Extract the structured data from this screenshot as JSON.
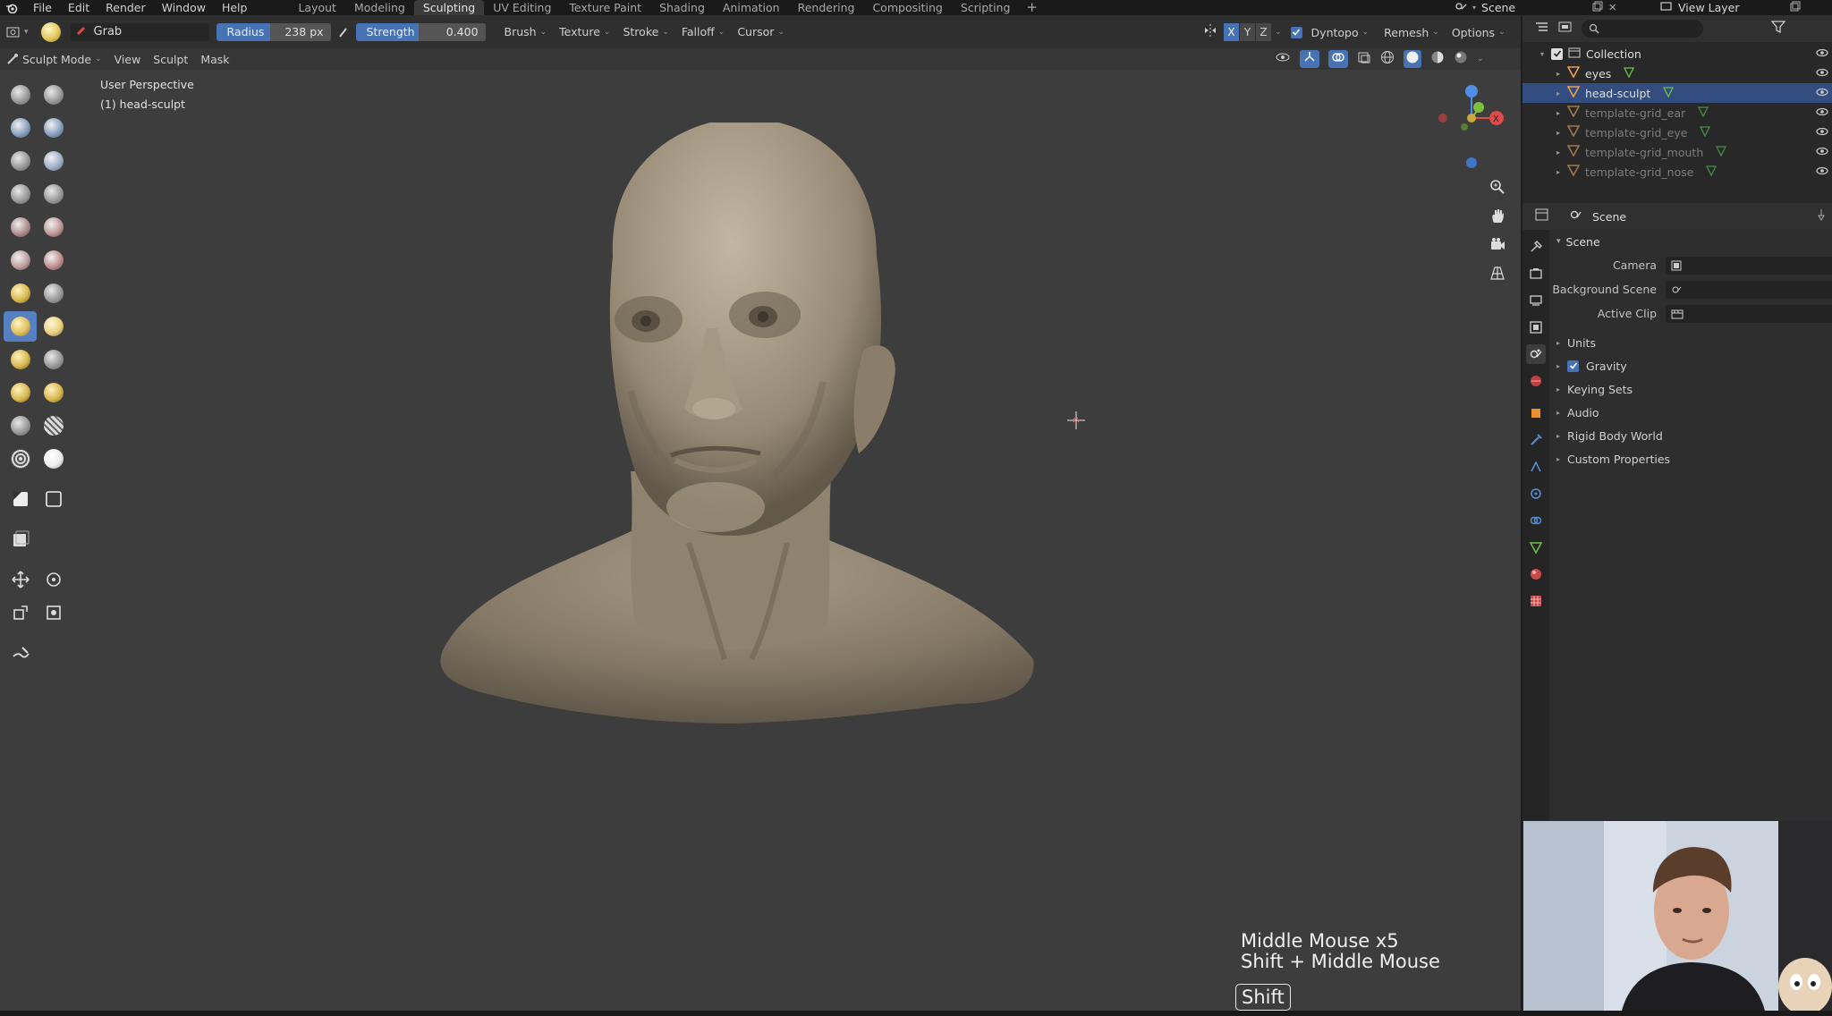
{
  "menubar": {
    "menus": [
      "File",
      "Edit",
      "Render",
      "Window",
      "Help"
    ],
    "workspaces": [
      {
        "label": "Layout",
        "active": false
      },
      {
        "label": "Modeling",
        "active": false
      },
      {
        "label": "Sculpting",
        "active": true
      },
      {
        "label": "UV Editing",
        "active": false
      },
      {
        "label": "Texture Paint",
        "active": false
      },
      {
        "label": "Shading",
        "active": false
      },
      {
        "label": "Animation",
        "active": false
      },
      {
        "label": "Rendering",
        "active": false
      },
      {
        "label": "Compositing",
        "active": false
      },
      {
        "label": "Scripting",
        "active": false
      }
    ],
    "add_workspace": "+",
    "scene": "Scene",
    "view_layer": "View Layer"
  },
  "tool_header": {
    "brush_name": "Grab",
    "radius_label": "Radius",
    "radius_value": "238 px",
    "strength_label": "Strength",
    "strength_value": "0.400",
    "dropdowns": [
      "Brush",
      "Texture",
      "Stroke",
      "Falloff",
      "Cursor"
    ],
    "axes": [
      "X",
      "Y",
      "Z"
    ],
    "dyntopo": "Dyntopo",
    "remesh": "Remesh",
    "options": "Options"
  },
  "mode_header": {
    "mode": "Sculpt Mode",
    "menus": [
      "View",
      "Sculpt",
      "Mask"
    ]
  },
  "viewport": {
    "perspective_label": "User Perspective",
    "object_label": "(1) head-sculpt",
    "screencast_lines": [
      "Middle Mouse x5",
      "Shift + Middle Mouse"
    ],
    "key_pressed": "Shift"
  },
  "outliner": {
    "items": [
      {
        "name": "Collection",
        "indent": 0,
        "selected": false,
        "muted": false
      },
      {
        "name": "eyes",
        "indent": 1,
        "selected": false,
        "muted": false
      },
      {
        "name": "head-sculpt",
        "indent": 1,
        "selected": true,
        "muted": false
      },
      {
        "name": "template-grid_ear",
        "indent": 1,
        "selected": false,
        "muted": true
      },
      {
        "name": "template-grid_eye",
        "indent": 1,
        "selected": false,
        "muted": true
      },
      {
        "name": "template-grid_mouth",
        "indent": 1,
        "selected": false,
        "muted": true
      },
      {
        "name": "template-grid_nose",
        "indent": 1,
        "selected": false,
        "muted": true
      }
    ]
  },
  "properties": {
    "context": "Scene",
    "panel": "Scene",
    "fields": [
      {
        "label": "Camera",
        "value": ""
      },
      {
        "label": "Background Scene",
        "value": ""
      },
      {
        "label": "Active Clip",
        "value": ""
      }
    ],
    "subpanels": [
      {
        "label": "Units",
        "checkbox": false
      },
      {
        "label": "Gravity",
        "checkbox": true
      },
      {
        "label": "Keying Sets",
        "checkbox": false
      },
      {
        "label": "Audio",
        "checkbox": false
      },
      {
        "label": "Rigid Body World",
        "checkbox": false
      },
      {
        "label": "Custom Properties",
        "checkbox": false
      }
    ]
  },
  "colors": {
    "accent": "#4772b3",
    "selected_row": "#334d80",
    "viewport_bg": "#3d3d3d",
    "axis_x": "#e04b4b",
    "axis_y": "#7fbf3f",
    "axis_z": "#4f8ee6"
  }
}
